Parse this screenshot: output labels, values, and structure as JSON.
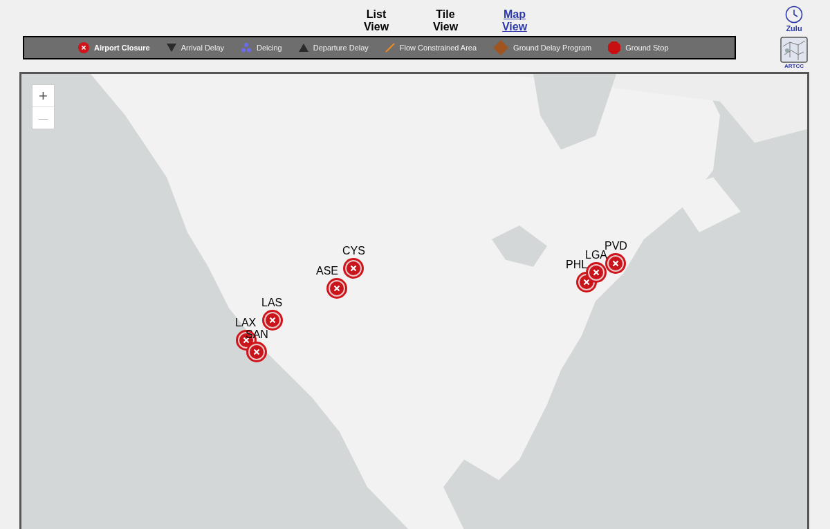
{
  "views": [
    {
      "label": "List View",
      "selected": false
    },
    {
      "label": "Tile View",
      "selected": false
    },
    {
      "label": "Map View",
      "selected": true
    }
  ],
  "legend": [
    {
      "kind": "closure",
      "label": "Airport Closure",
      "selected": true
    },
    {
      "kind": "arrival",
      "label": "Arrival Delay",
      "selected": false
    },
    {
      "kind": "deicing",
      "label": "Deicing",
      "selected": false
    },
    {
      "kind": "departure",
      "label": "Departure Delay",
      "selected": false
    },
    {
      "kind": "flow",
      "label": "Flow Constrained Area",
      "selected": false
    },
    {
      "kind": "gdp",
      "label": "Ground Delay Program",
      "selected": false
    },
    {
      "kind": "ground_stop",
      "label": "Ground Stop",
      "selected": false
    }
  ],
  "zulu": {
    "label": "Zulu"
  },
  "artcc": {
    "label": "ARTCC"
  },
  "map": {
    "zoom_in": "+",
    "zoom_out": "—",
    "airports": [
      {
        "code": "CYS",
        "kind": "closure"
      },
      {
        "code": "ASE",
        "kind": "closure"
      },
      {
        "code": "LAS",
        "kind": "closure"
      },
      {
        "code": "LAX",
        "kind": "closure"
      },
      {
        "code": "SAN",
        "kind": "closure"
      },
      {
        "code": "PHL",
        "kind": "closure"
      },
      {
        "code": "LGA",
        "kind": "closure"
      },
      {
        "code": "PVD",
        "kind": "closure"
      }
    ]
  }
}
